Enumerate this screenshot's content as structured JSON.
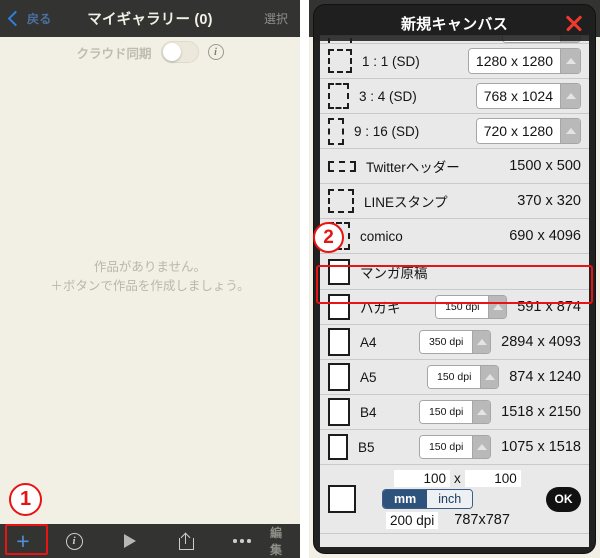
{
  "gallery": {
    "header": {
      "back_label": "戻る",
      "title": "マイギャラリー (0)",
      "select_label": "選択"
    },
    "cloud_sync": {
      "label": "クラウド同期",
      "toggle_state": "off"
    },
    "empty_state": {
      "line1": "作品がありません。",
      "line2": "＋ボタンで作品を作成しましょう。"
    },
    "toolbar": {
      "add_label": "+",
      "info_label": "i",
      "edit_label": "編集"
    },
    "annotations": {
      "step1": "1"
    }
  },
  "modal": {
    "title": "新規キャンバス",
    "close_label": "×",
    "annotations": {
      "step2": "2"
    },
    "rows": [
      {
        "label": "",
        "value": "",
        "kind": "clipped"
      },
      {
        "label": "1 : 1 (SD)",
        "value": "1280 x 1280",
        "kind": "stepper",
        "thumb": "dashed",
        "tw": 24,
        "th": 24
      },
      {
        "label": "3 : 4 (SD)",
        "value": "768 x 1024",
        "kind": "stepper",
        "thumb": "dashed",
        "tw": 21,
        "th": 26
      },
      {
        "label": "9 : 16 (SD)",
        "value": "720 x 1280",
        "kind": "stepper",
        "thumb": "dashed",
        "tw": 16,
        "th": 27
      },
      {
        "label": "Twitterヘッダー",
        "value": "1500 x 500",
        "kind": "plain",
        "thumb": "dashed",
        "tw": 28,
        "th": 11
      },
      {
        "label": "LINEスタンプ",
        "value": "370 x 320",
        "kind": "plain",
        "thumb": "dashed",
        "tw": 26,
        "th": 24
      },
      {
        "label": "comico",
        "value": "690 x 4096",
        "kind": "plain",
        "thumb": "dashed",
        "tw": 22,
        "th": 28
      },
      {
        "label": "マンガ原稿",
        "value": "",
        "kind": "plain",
        "thumb": "solid",
        "tw": 22,
        "th": 26,
        "highlight": true
      },
      {
        "label": "ハガキ",
        "value": "591 x 874",
        "kind": "dpi",
        "dpi": "150 dpi",
        "thumb": "solid",
        "tw": 22,
        "th": 26
      },
      {
        "label": "A4",
        "value": "2894 x 4093",
        "kind": "dpi",
        "dpi": "350 dpi",
        "thumb": "solid",
        "tw": 22,
        "th": 28
      },
      {
        "label": "A5",
        "value": "874 x 1240",
        "kind": "dpi",
        "dpi": "150 dpi",
        "thumb": "solid",
        "tw": 22,
        "th": 28
      },
      {
        "label": "B4",
        "value": "1518 x 2150",
        "kind": "dpi",
        "dpi": "150 dpi",
        "thumb": "solid",
        "tw": 22,
        "th": 28
      },
      {
        "label": "B5",
        "value": "1075 x 1518",
        "kind": "dpi",
        "dpi": "150 dpi",
        "thumb": "solid",
        "tw": 20,
        "th": 26
      }
    ],
    "custom": {
      "width": "100",
      "separator": "x",
      "height": "100",
      "unit_mm": "mm",
      "unit_inch": "inch",
      "unit_selected": "mm",
      "dpi": "200 dpi",
      "result": "787x787",
      "ok_label": "OK"
    }
  },
  "colors": {
    "header_bar": "#333331",
    "gallery_bg": "#f2f0e4",
    "accent_blue": "#4f8fd6",
    "highlight_red": "#e81313",
    "modal_bg": "#212121",
    "list_bg": "#e9e9e9",
    "unit_active": "#2d527c"
  }
}
